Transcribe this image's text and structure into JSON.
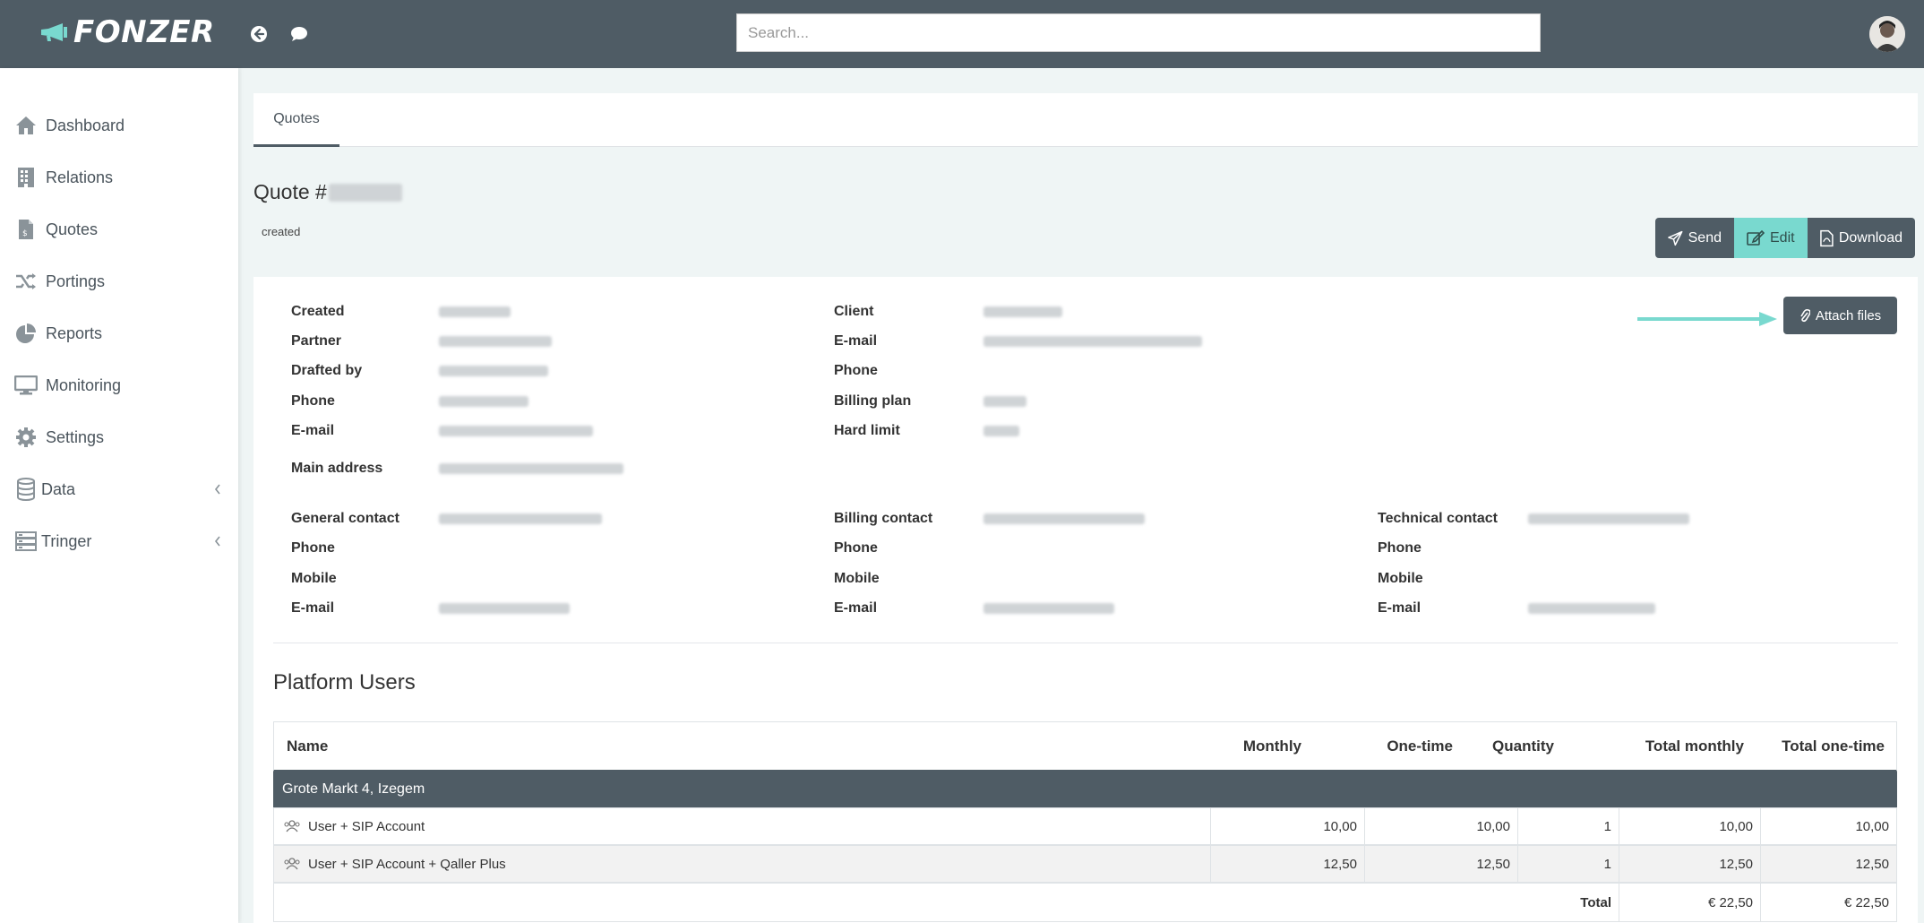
{
  "app": {
    "logo_text": "FONZER",
    "accent_color": "#79d9cf",
    "header_color": "#4f5c65"
  },
  "search": {
    "placeholder": "Search..."
  },
  "sidebar": {
    "items": [
      {
        "label": "Dashboard",
        "icon": "home-icon"
      },
      {
        "label": "Relations",
        "icon": "building-icon"
      },
      {
        "label": "Quotes",
        "icon": "file-invoice-icon"
      },
      {
        "label": "Portings",
        "icon": "shuffle-icon"
      },
      {
        "label": "Reports",
        "icon": "pie-chart-icon"
      },
      {
        "label": "Monitoring",
        "icon": "monitor-icon"
      },
      {
        "label": "Settings",
        "icon": "gear-icon"
      },
      {
        "label": "Data",
        "icon": "database-icon"
      },
      {
        "label": "Tringer",
        "icon": "server-icon"
      }
    ]
  },
  "tabs": [
    {
      "label": "Quotes"
    }
  ],
  "quote": {
    "title_prefix": "Quote #",
    "status": "created"
  },
  "actions": {
    "send": "Send",
    "edit": "Edit",
    "download": "Download",
    "attach": "Attach files"
  },
  "details": {
    "created": "Created",
    "partner": "Partner",
    "drafted_by": "Drafted by",
    "phone": "Phone",
    "email": "E-mail",
    "main_address": "Main address",
    "client": "Client",
    "client_email": "E-mail",
    "client_phone": "Phone",
    "billing_plan": "Billing plan",
    "hard_limit": "Hard limit"
  },
  "contacts": {
    "general": {
      "title": "General contact",
      "phone": "Phone",
      "mobile": "Mobile",
      "email": "E-mail"
    },
    "billing": {
      "title": "Billing contact",
      "phone": "Phone",
      "mobile": "Mobile",
      "email": "E-mail"
    },
    "technical": {
      "title": "Technical contact",
      "phone": "Phone",
      "mobile": "Mobile",
      "email": "E-mail"
    }
  },
  "platform_users": {
    "title": "Platform Users",
    "columns": [
      "Name",
      "Monthly",
      "One-time",
      "Quantity",
      "Total monthly",
      "Total one-time"
    ],
    "group": "Grote Markt 4, Izegem",
    "rows": [
      {
        "name": "User + SIP Account",
        "monthly": "10,00",
        "one_time": "10,00",
        "quantity": "1",
        "total_monthly": "10,00",
        "total_one_time": "10,00"
      },
      {
        "name": "User + SIP Account + Qaller Plus",
        "monthly": "12,50",
        "one_time": "12,50",
        "quantity": "1",
        "total_monthly": "12,50",
        "total_one_time": "12,50"
      }
    ],
    "total": {
      "label": "Total",
      "monthly": "€ 22,50",
      "one_time": "€ 22,50"
    }
  }
}
